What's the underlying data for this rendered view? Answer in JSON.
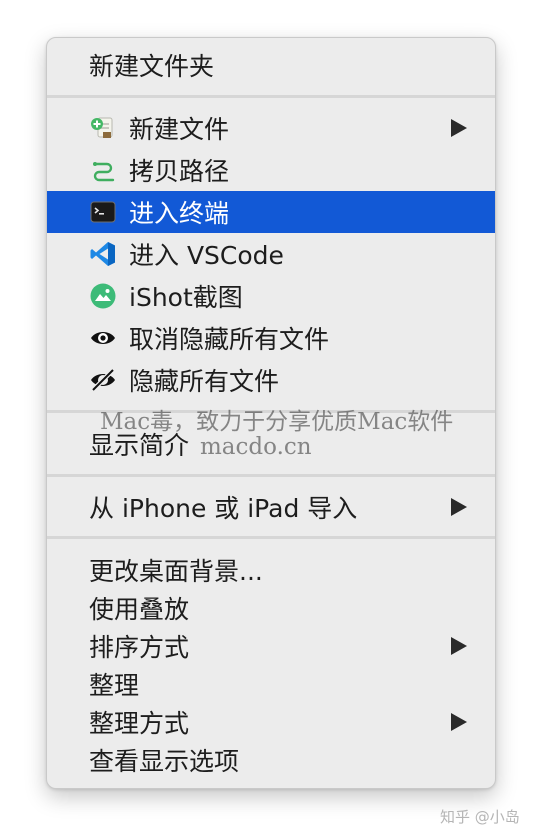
{
  "menu": {
    "items": [
      {
        "label": "新建文件夹"
      },
      {
        "label": "新建文件",
        "icon": "new-file-icon",
        "has_submenu": true
      },
      {
        "label": "拷贝路径",
        "icon": "copy-path-icon"
      },
      {
        "label": "进入终端",
        "icon": "terminal-icon",
        "selected": true
      },
      {
        "label": "进入 VSCode",
        "icon": "vscode-icon"
      },
      {
        "label": "iShot截图",
        "icon": "ishot-icon"
      },
      {
        "label": "取消隐藏所有文件",
        "icon": "eye-icon"
      },
      {
        "label": "隐藏所有文件",
        "icon": "eye-slash-icon"
      },
      {
        "label": "显示简介"
      },
      {
        "label": "从 iPhone 或 iPad 导入",
        "has_submenu": true
      },
      {
        "label": "更改桌面背景..."
      },
      {
        "label": "使用叠放"
      },
      {
        "label": "排序方式",
        "has_submenu": true
      },
      {
        "label": "整理"
      },
      {
        "label": "整理方式",
        "has_submenu": true
      },
      {
        "label": "查看显示选项"
      }
    ]
  },
  "watermark": {
    "line1": "Mac毒，致力于分享优质Mac软件",
    "line2": "macdo.cn"
  },
  "credit": "知乎 @小岛",
  "colors": {
    "selection": "#1259d6",
    "menu_bg": "#ececec"
  }
}
